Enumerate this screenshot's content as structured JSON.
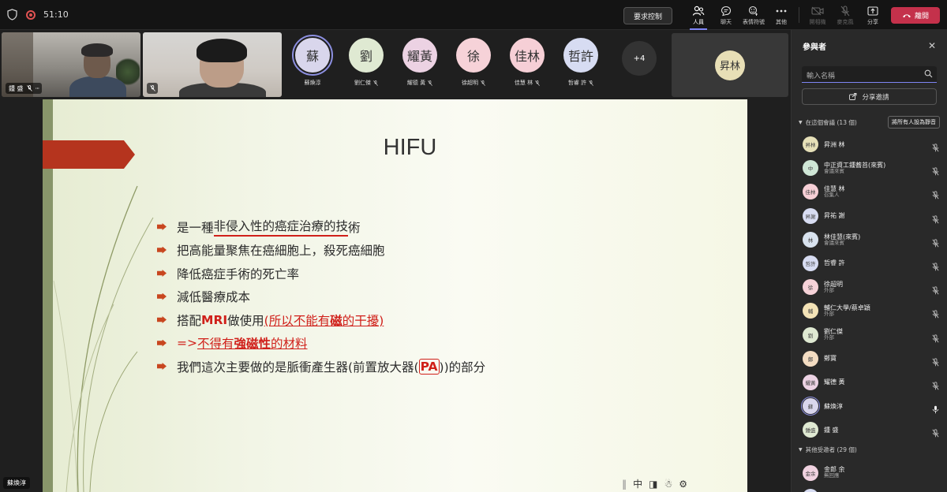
{
  "topbar": {
    "timer": "51:10",
    "request_control": "要求控制",
    "items": [
      {
        "label": "人員",
        "icon": "people-icon",
        "active": true
      },
      {
        "label": "聊天",
        "icon": "chat-icon"
      },
      {
        "label": "表情符號",
        "icon": "emoji-icon"
      },
      {
        "label": "其他",
        "icon": "more-icon"
      },
      {
        "label": "開相機",
        "icon": "camera-off-icon",
        "dim": true
      },
      {
        "label": "麥克風",
        "icon": "mic-off-icon",
        "dim": true
      },
      {
        "label": "分享",
        "icon": "share-icon"
      }
    ],
    "leave": "離開"
  },
  "videos": [
    {
      "name": "鍾 盛"
    },
    {
      "name": ""
    }
  ],
  "participants_row": [
    {
      "initials": "蘇",
      "name": "蘇煥淳",
      "color": "#d9d6ec",
      "speaking": true,
      "muted": false
    },
    {
      "initials": "劉",
      "name": "劉仁傑",
      "color": "#dfe9d2",
      "muted": true
    },
    {
      "initials": "耀黃",
      "name": "耀德 黃",
      "color": "#ecd2e3",
      "muted": true
    },
    {
      "initials": "徐",
      "name": "徐超明",
      "color": "#f6d2d8",
      "muted": true
    },
    {
      "initials": "佳林",
      "name": "佳慧 林",
      "color": "#f6cfd6",
      "muted": true
    },
    {
      "initials": "哲許",
      "name": "哲睿 許",
      "color": "#d7dcf2",
      "muted": true
    }
  ],
  "more_count": "+4",
  "big_tile": {
    "initials": "昇林"
  },
  "slide": {
    "title": "HIFU",
    "bullets": [
      {
        "parts": [
          {
            "t": "是一種"
          },
          {
            "t": "非侵入性的癌症治療的技",
            "cls": "ul-curve"
          },
          {
            "t": "術"
          }
        ]
      },
      {
        "parts": [
          {
            "t": "把高能量聚焦在癌細胞上，殺死癌細胞"
          }
        ]
      },
      {
        "parts": [
          {
            "t": "降低癌症手術的死亡率"
          }
        ]
      },
      {
        "parts": [
          {
            "t": "減低醫療成本"
          }
        ]
      },
      {
        "parts": [
          {
            "t": "搭配"
          },
          {
            "t": "MRI",
            "cls": "red bold"
          },
          {
            "t": "做使用 "
          },
          {
            "t": "(所以不能有",
            "cls": "red ul"
          },
          {
            "t": "磁",
            "cls": "red bold ul"
          },
          {
            "t": "的干擾)",
            "cls": "red ul"
          }
        ]
      },
      {
        "parts": [
          {
            "t": "=> ",
            "cls": "red"
          },
          {
            "t": "不得有",
            "cls": "red ul"
          },
          {
            "t": "強磁性",
            "cls": "red bold ul"
          },
          {
            "t": "的材料",
            "cls": "red ul"
          }
        ]
      },
      {
        "parts": [
          {
            "t": "我們這次主要做的是脈衝產生器(前置放大器("
          },
          {
            "t": "PA",
            "cls": "red bold boxed"
          },
          {
            "t": "))的部分"
          }
        ]
      }
    ],
    "toolbar_char": "中"
  },
  "presenter_name": "蘇煥淳",
  "panel": {
    "title": "參與者",
    "search_placeholder": "輸入名稱",
    "share_invite": "分享邀請",
    "in_meeting_label": "在這個會議 (13 個)",
    "mute_all": "將所有人設為靜音",
    "people": [
      {
        "initials": "昇林",
        "name": "昇洲 林",
        "role": "",
        "color": "#e6e0b8",
        "mic": "off"
      },
      {
        "initials": "中",
        "name": "中正資工鍾蕎苔(來賓)",
        "role": "會議來賓",
        "color": "#cfe6d6",
        "mic": "off"
      },
      {
        "initials": "佳林",
        "name": "佳慧 林",
        "role": "召集人",
        "color": "#f6cfd6",
        "mic": "off"
      },
      {
        "initials": "昇謝",
        "name": "昇祐 謝",
        "role": "",
        "color": "#d7dcf2",
        "mic": "off"
      },
      {
        "initials": "林",
        "name": "林佳慧(來賓)",
        "role": "會議來賓",
        "color": "#d8e2ee",
        "mic": "off"
      },
      {
        "initials": "哲許",
        "name": "哲睿 許",
        "role": "",
        "color": "#d7dcf2",
        "mic": "off"
      },
      {
        "initials": "徐",
        "name": "徐超明",
        "role": "外部",
        "color": "#f6d2d8",
        "mic": "off"
      },
      {
        "initials": "輔",
        "name": "輔仁大學/蔡卓穎",
        "role": "外部",
        "color": "#f3e2b6",
        "mic": "off"
      },
      {
        "initials": "劉",
        "name": "劉仁傑",
        "role": "外部",
        "color": "#dfe9d2",
        "mic": "off"
      },
      {
        "initials": "鄭",
        "name": "鄭寶",
        "role": "",
        "color": "#f3dcc2",
        "mic": "off"
      },
      {
        "initials": "耀黃",
        "name": "耀德 黃",
        "role": "",
        "color": "#ecd2e3",
        "mic": "off"
      },
      {
        "initials": "蘇",
        "name": "蘇煥淳",
        "role": "",
        "color": "#d9d6ec",
        "mic": "on",
        "speaking": true
      },
      {
        "initials": "鍾盛",
        "name": "鍾 盛",
        "role": "",
        "color": "#dfe9d2",
        "mic": "off"
      }
    ],
    "other_invited_label": "其他受邀者 (29 個)",
    "invited": [
      {
        "initials": "金余",
        "name": "金郎 余",
        "role": "無回應",
        "color": "#f0d2e0"
      },
      {
        "initials": "黃",
        "name": "黃文良",
        "role": "",
        "color": "#d7dcf2"
      }
    ]
  }
}
